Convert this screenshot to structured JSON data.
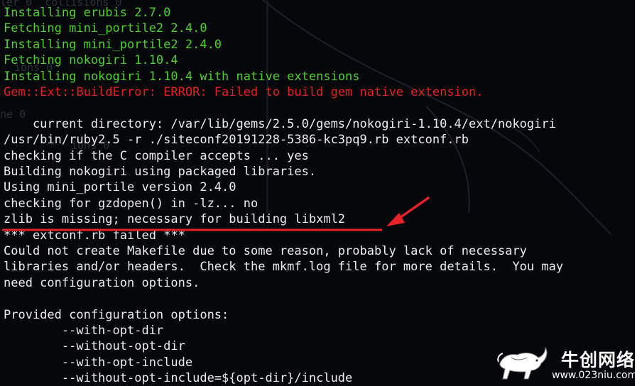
{
  "terminal": {
    "background_color": "#05070a",
    "colors": {
      "green": "#4dd12a",
      "red": "#e81f1f",
      "white": "#ececec",
      "annotation": "#e8202a"
    },
    "lines": [
      {
        "text": "Installing erubis 2.7.0",
        "color": "green"
      },
      {
        "text": "Fetching mini_portile2 2.4.0",
        "color": "green"
      },
      {
        "text": "Installing mini_portile2 2.4.0",
        "color": "green"
      },
      {
        "text": "Fetching nokogiri 1.10.4",
        "color": "green"
      },
      {
        "text": "Installing nokogiri 1.10.4 with native extensions",
        "color": "green"
      },
      {
        "text": "Gem::Ext::BuildError: ERROR: Failed to build gem native extension.",
        "color": "red"
      },
      {
        "text": "",
        "color": "white"
      },
      {
        "text": "    current directory: /var/lib/gems/2.5.0/gems/nokogiri-1.10.4/ext/nokogiri",
        "color": "white"
      },
      {
        "text": "/usr/bin/ruby2.5 -r ./siteconf20191228-5386-kc3pq9.rb extconf.rb",
        "color": "white"
      },
      {
        "text": "checking if the C compiler accepts ... yes",
        "color": "white"
      },
      {
        "text": "Building nokogiri using packaged libraries.",
        "color": "white"
      },
      {
        "text": "Using mini_portile version 2.4.0",
        "color": "white"
      },
      {
        "text": "checking for gzdopen() in -lz... no",
        "color": "white"
      },
      {
        "text": "zlib is missing; necessary for building libxml2",
        "color": "white"
      },
      {
        "text": "*** extconf.rb failed ***",
        "color": "white"
      },
      {
        "text": "Could not create Makefile due to some reason, probably lack of necessary",
        "color": "white"
      },
      {
        "text": "libraries and/or headers.  Check the mkmf.log file for more details.  You may",
        "color": "white"
      },
      {
        "text": "need configuration options.",
        "color": "white"
      },
      {
        "text": "",
        "color": "white"
      },
      {
        "text": "Provided configuration options:",
        "color": "white"
      },
      {
        "text": "        --with-opt-dir",
        "color": "white"
      },
      {
        "text": "        --without-opt-dir",
        "color": "white"
      },
      {
        "text": "        --with-opt-include",
        "color": "white"
      },
      {
        "text": "        --without-opt-include=${opt-dir}/include",
        "color": "white"
      }
    ],
    "background_ghost_text": [
      "ler 0  collisions 0",
      "ne 0",
      "ions 0",
      "ions 0"
    ]
  },
  "annotation": {
    "highlighted_line": "zlib is missing; necessary for building libxml2",
    "arrow_icon": "red-arrow-icon",
    "underline_color": "#e8202a"
  },
  "watermark": {
    "brand_text": "牛创网络",
    "url_text": "www.023niu.com",
    "logo_icon": "bull-logo-icon"
  }
}
